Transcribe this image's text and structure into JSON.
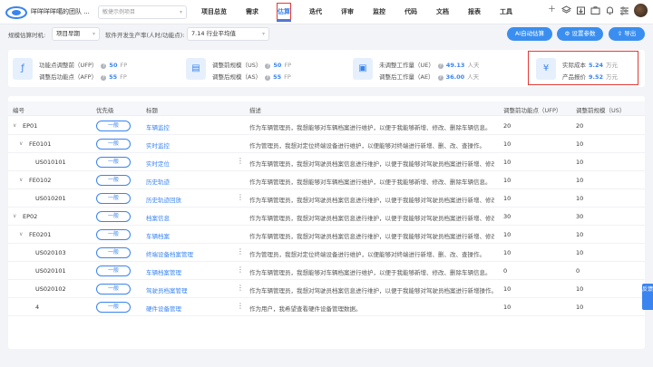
{
  "topbar": {
    "team_name": "咩咩咩咩噶的团队 ...",
    "project": "敏捷示例项目",
    "nav": [
      {
        "label": "项目总览"
      },
      {
        "label": "需求"
      },
      {
        "label": "估算",
        "active": true
      },
      {
        "label": "迭代"
      },
      {
        "label": "评审"
      },
      {
        "label": "监控"
      },
      {
        "label": "代码"
      },
      {
        "label": "文档"
      },
      {
        "label": "报表"
      },
      {
        "label": "工具"
      }
    ],
    "tools": [
      "plus-icon",
      "layers-icon",
      "export-icon",
      "briefcase-icon",
      "bell-icon",
      "settings-sliders-icon",
      "avatar"
    ]
  },
  "toolbar": {
    "scale_timing_label": "规模估算时机:",
    "scale_timing_value": "项目早期",
    "productivity_label": "软件开发生产率(人时/功能点):",
    "productivity_value": "7.14  行业平均值",
    "ai_button": "AI自动估算",
    "settings_button": "设置参数",
    "export_button": "导出"
  },
  "metrics": {
    "fp": {
      "ufp_label": "功能点调整前（UFP）",
      "ufp_value": "50",
      "ufp_unit": "FP",
      "afp_label": "调整后功能点（AFP）",
      "afp_value": "55",
      "afp_unit": "FP"
    },
    "scale": {
      "us_label": "调整前规模（US）",
      "us_value": "50",
      "us_unit": "FP",
      "as_label": "调整后规模（AS）",
      "as_value": "55",
      "as_unit": "FP"
    },
    "effort": {
      "ue_label": "未调整工作量（UE）",
      "ue_value": "49.13",
      "ue_unit": "人天",
      "ae_label": "调整后工作量（AE）",
      "ae_value": "36.00",
      "ae_unit": "人天"
    },
    "cost": {
      "actual_label": "实际成本",
      "actual_value": "5.24",
      "actual_unit": "万元",
      "quote_label": "产品报价",
      "quote_value": "9.52",
      "quote_unit": "万元"
    }
  },
  "table": {
    "headers": [
      "编号",
      "优先级",
      "标题",
      "描述",
      "调整前功能点（UFP）",
      "调整前规模（US）"
    ],
    "rows": [
      {
        "id": "EP01",
        "level": 0,
        "expandable": true,
        "priority": "一般",
        "title": "车辆监控",
        "desc": "作为车辆管理员，我想能够对车辆档案进行维护，以便于我能够新增、修改、删除车辆信息。",
        "ufp": "20",
        "us": "20",
        "menu": false
      },
      {
        "id": "FE0101",
        "level": 1,
        "expandable": true,
        "priority": "一般",
        "title": "实时监控",
        "desc": "作为管理员，我想对定位终端设备进行维护，以便能够对终端进行新增、删、改、查操作。",
        "ufp": "10",
        "us": "10",
        "menu": false
      },
      {
        "id": "US010101",
        "level": 2,
        "expandable": false,
        "priority": "一般",
        "title": "实时定位",
        "desc": "作为车辆管理员，我想对驾驶员档案信息进行维护，以便于我能够对驾驶员档案进行新增、修改",
        "ufp": "10",
        "us": "10",
        "menu": true
      },
      {
        "id": "FE0102",
        "level": 1,
        "expandable": true,
        "priority": "一般",
        "title": "历史轨迹",
        "desc": "作为车辆管理员，我想能够对车辆档案进行维护，以便于我能够新增、修改、删除车辆信息。",
        "ufp": "10",
        "us": "10",
        "menu": false
      },
      {
        "id": "US010201",
        "level": 2,
        "expandable": false,
        "priority": "一般",
        "title": "历史轨迹回放",
        "desc": "作为车辆管理员，我想对驾驶员档案信息进行维护，以便于我能够对驾驶员档案进行新增、修改",
        "ufp": "10",
        "us": "10",
        "menu": true
      },
      {
        "id": "EP02",
        "level": 0,
        "expandable": true,
        "priority": "一般",
        "title": "档案信息",
        "desc": "作为车辆管理员，我想对驾驶员档案信息进行维护，以便于我能够对驾驶员档案进行新增、修改",
        "ufp": "30",
        "us": "30",
        "menu": false
      },
      {
        "id": "FE0201",
        "level": 1,
        "expandable": true,
        "priority": "一般",
        "title": "车辆档案",
        "desc": "作为车辆管理员，我想对驾驶员档案信息进行维护，以便于我能够对驾驶员档案进行新增、修改",
        "ufp": "10",
        "us": "10",
        "menu": false
      },
      {
        "id": "US020103",
        "level": 2,
        "expandable": false,
        "priority": "一般",
        "title": "终端设备档案管理",
        "desc": "作为管理员，我想对定位终端设备进行维护，以便能够对终端进行新增、删、改、查操作。",
        "ufp": "10",
        "us": "10",
        "menu": true
      },
      {
        "id": "US020101",
        "level": 2,
        "expandable": false,
        "priority": "一般",
        "title": "车辆档案管理",
        "desc": "作为车辆管理员，我想能够对车辆档案进行维护，以便于我能够新增、修改、删除车辆信息。",
        "ufp": "0",
        "us": "0",
        "menu": true
      },
      {
        "id": "US020102",
        "level": 2,
        "expandable": false,
        "priority": "一般",
        "title": "驾驶员档案管理",
        "desc": "作为车辆管理员，我想对驾驶员档案信息进行维护，以便于我能够对驾驶员档案进行新增操作。",
        "ufp": "10",
        "us": "10",
        "menu": true
      },
      {
        "id": "4",
        "level": 2,
        "expandable": false,
        "priority": "一般",
        "title": "硬件设备管理",
        "desc": "作为用户，我希望查看硬件设备管理数据。",
        "ufp": "10",
        "us": "10",
        "menu": true
      }
    ]
  },
  "feedback_label": "反馈",
  "colors": {
    "accent": "#3a84f0",
    "highlight": "#e53935"
  }
}
